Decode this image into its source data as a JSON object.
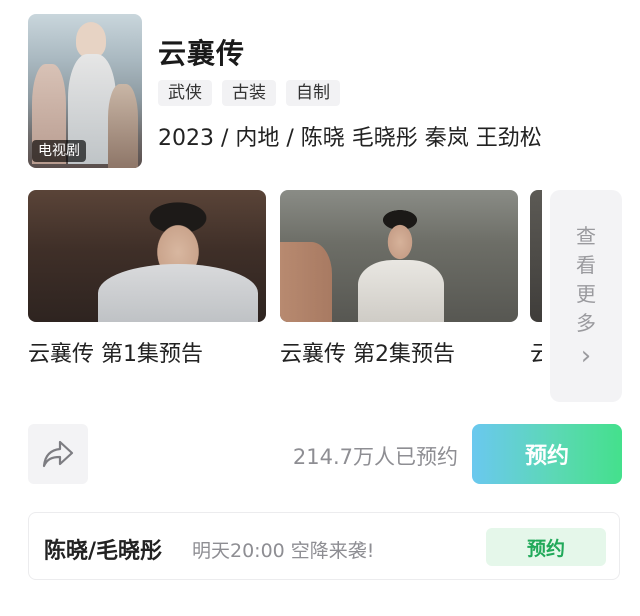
{
  "show": {
    "title": "云襄传",
    "poster_badge": "电视剧",
    "tags": [
      "武侠",
      "古装",
      "自制"
    ],
    "meta": "2023 / 内地 / 陈晓 毛晓彤 秦岚 王劲松"
  },
  "clips": [
    {
      "caption": "云襄传 第1集预告"
    },
    {
      "caption": "云襄传 第2集预告"
    },
    {
      "caption": "云"
    }
  ],
  "more": {
    "chars": [
      "查",
      "看",
      "更",
      "多"
    ],
    "chevron": "›"
  },
  "reserve": {
    "count_text": "214.7万人已预约",
    "button_label": "预约",
    "share_icon": "share-arrow-icon"
  },
  "live": {
    "names": "陈晓/毛晓彤",
    "desc": "明天20:00 空降来袭!",
    "button_label": "预约"
  },
  "colors": {
    "reserve_gradient": [
      "#6ac8ef",
      "#44e08c"
    ],
    "live_button_bg": "#e5f7ea",
    "live_button_text": "#21a95a"
  }
}
